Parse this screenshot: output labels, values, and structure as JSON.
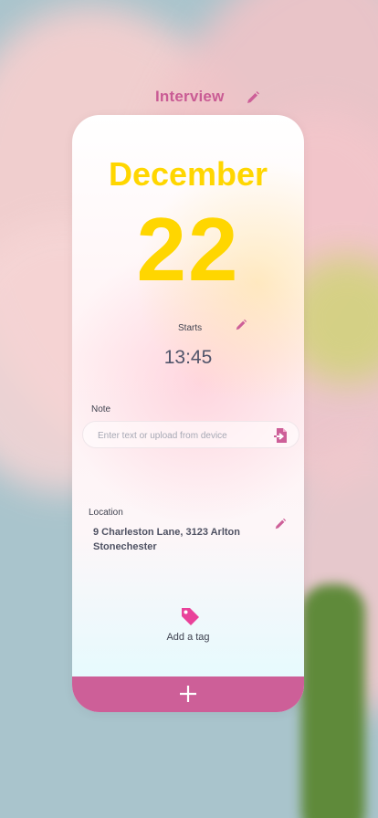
{
  "header": {
    "title": "Interview"
  },
  "date": {
    "month": "December",
    "day": "22"
  },
  "starts": {
    "label": "Starts",
    "time": "13:45"
  },
  "note": {
    "label": "Note",
    "placeholder": "Enter text or upload from device",
    "value": ""
  },
  "location": {
    "label": "Location",
    "line1": "9 Charleston Lane, 3123 Arlton",
    "line2": "Stonechester"
  },
  "tag": {
    "label": "Add a tag"
  },
  "icons": [
    "pencil-icon",
    "upload-file-icon",
    "tag-icon",
    "plus-icon"
  ],
  "colors": {
    "accent": "#cd5f98",
    "date": "#ffd600",
    "text": "#404350"
  }
}
